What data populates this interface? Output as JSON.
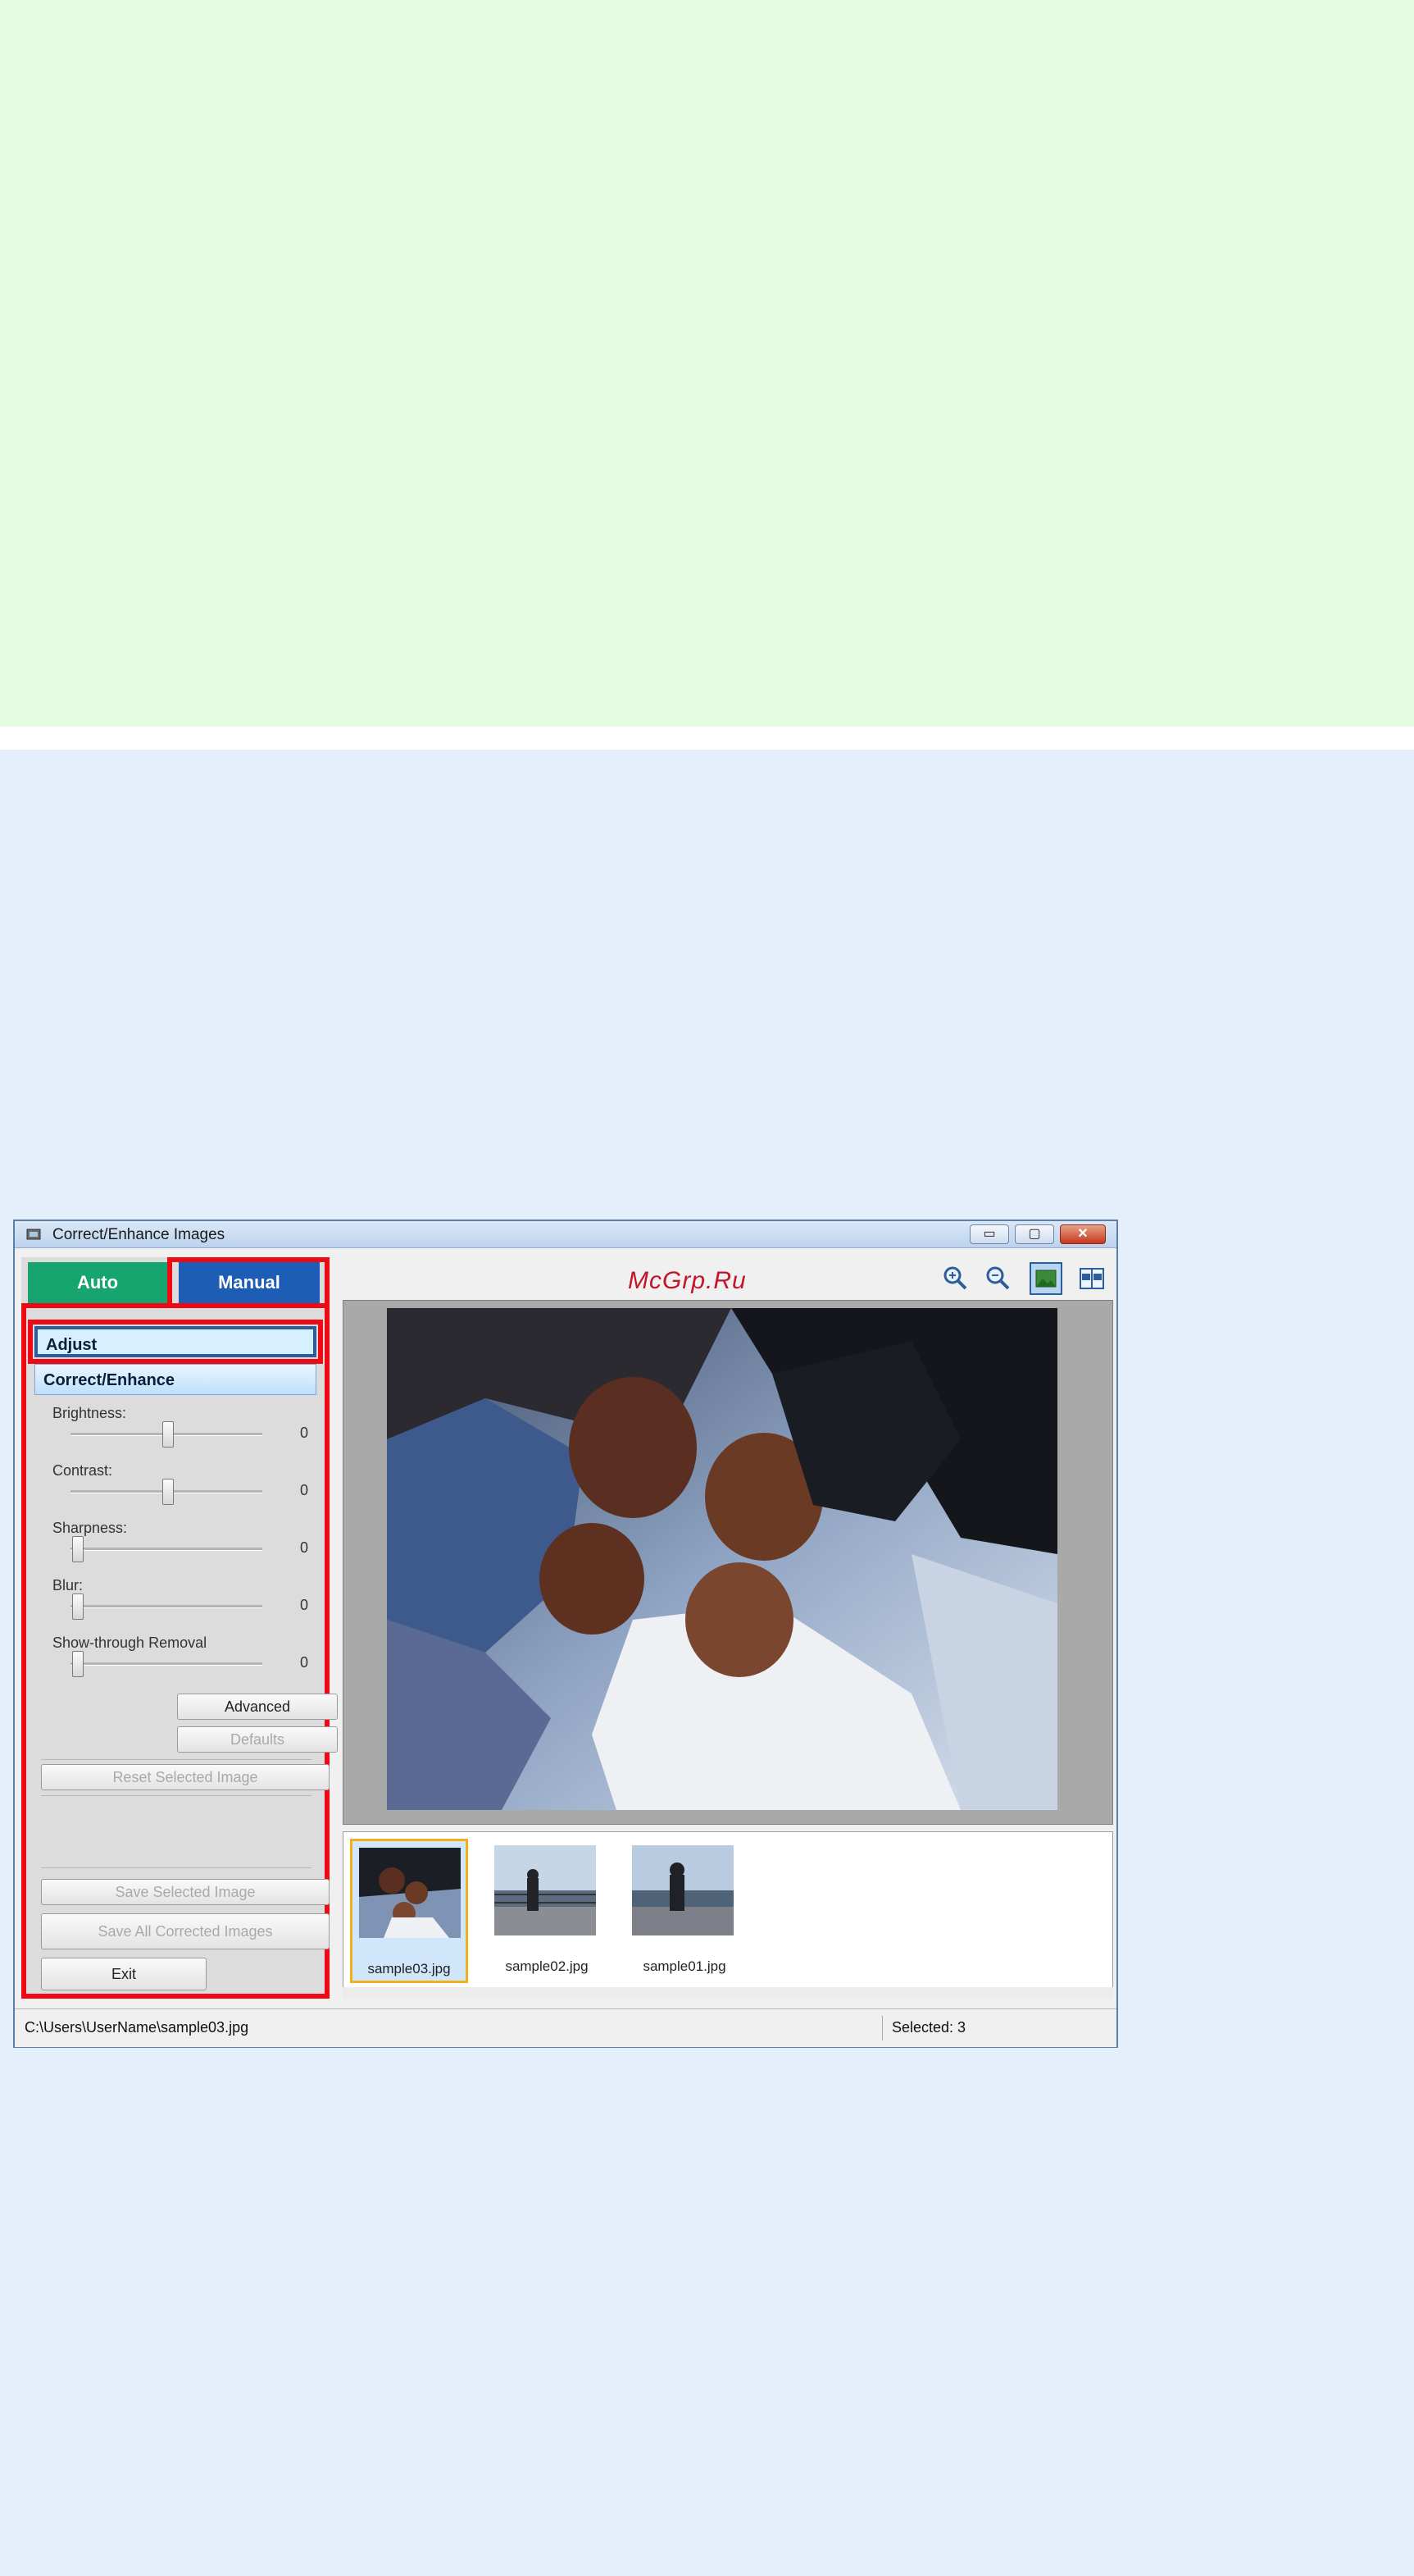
{
  "window": {
    "title": "Correct/Enhance Images",
    "controls": {
      "minimize": "▭",
      "maximize": "▢",
      "close": "✕"
    }
  },
  "tabs": {
    "auto": "Auto",
    "manual": "Manual"
  },
  "sections": {
    "adjust": "Adjust",
    "correct_enhance": "Correct/Enhance"
  },
  "sliders": [
    {
      "label": "Brightness:",
      "value": "0"
    },
    {
      "label": "Contrast:",
      "value": "0"
    },
    {
      "label": "Sharpness:",
      "value": "0"
    },
    {
      "label": "Blur:",
      "value": "0"
    },
    {
      "label": "Show-through Removal",
      "value": "0"
    }
  ],
  "buttons": {
    "advanced": "Advanced",
    "defaults": "Defaults",
    "reset_selected": "Reset Selected Image",
    "save_selected": "Save Selected Image",
    "save_all": "Save All Corrected Images",
    "exit": "Exit"
  },
  "watermark": "McGrp.Ru",
  "toolbar_icons": [
    "zoom-in-icon",
    "zoom-out-icon",
    "whole-image-icon",
    "compare-view-icon"
  ],
  "thumbnails": [
    {
      "label": "sample03.jpg",
      "selected": true
    },
    {
      "label": "sample02.jpg",
      "selected": false
    },
    {
      "label": "sample01.jpg",
      "selected": false
    }
  ],
  "status": {
    "path": "C:\\Users\\UserName\\sample03.jpg",
    "selected": "Selected: 3"
  },
  "colors": {
    "highlight_red": "#ee0a14",
    "auto_tab": "#16a56f",
    "manual_tab": "#1d5db5",
    "selected_thumb_border": "#f3b01b"
  }
}
